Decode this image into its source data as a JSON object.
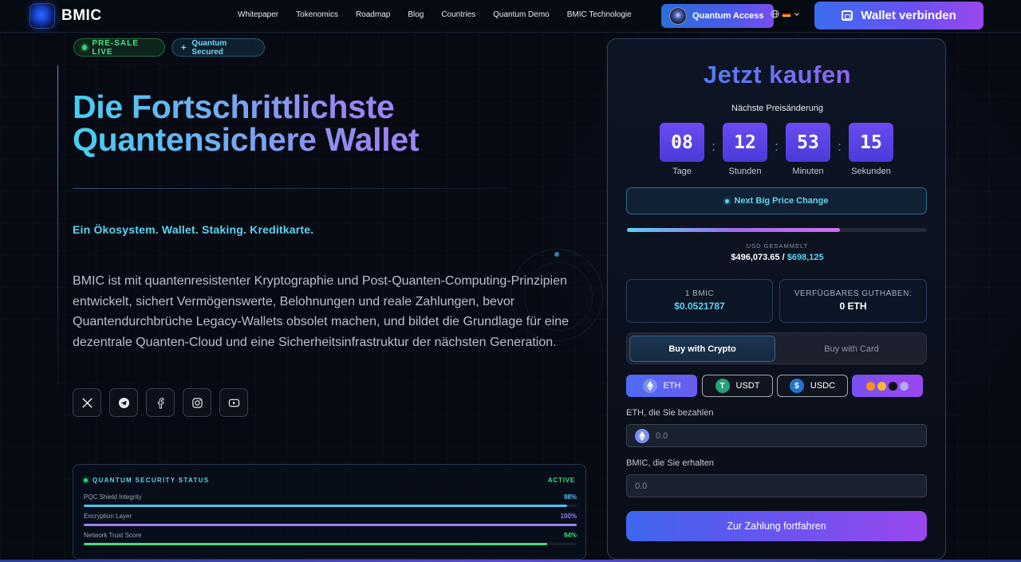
{
  "nav": {
    "logo": "BMIC",
    "links": [
      "Whitepaper",
      "Tokenomics",
      "Roadmap",
      "Blog",
      "Countries",
      "Quantum Demo",
      "BMIC Technologie"
    ],
    "quantum_access": "Quantum Access",
    "wallet_button": "Wallet verbinden"
  },
  "hero": {
    "badge_live": "PRE-SALE LIVE",
    "badge_secured": "Quantum Secured",
    "title_line1": "Die Fortschrittlichste",
    "title_line2": "Quantensichere Wallet",
    "tagline": "Ein Ökosystem. Wallet. Staking. Kreditkarte.",
    "description": "BMIC ist mit quantenresistenter Kryptographie und Post-Quanten-Computing-Prinzipien entwickelt, sichert Vermögenswerte, Belohnungen und reale Zahlungen, bevor Quantendurchbrüche Legacy-Wallets obsolet machen, und bildet die Grundlage für eine dezentrale Quanten-Cloud und eine Sicherheitsinfrastruktur der nächsten Generation.",
    "socials": [
      "x-icon",
      "telegram-icon",
      "facebook-icon",
      "instagram-icon",
      "youtube-icon"
    ]
  },
  "security": {
    "title": "QUANTUM SECURITY STATUS",
    "status": "ACTIVE",
    "metrics": [
      {
        "label": "PQC Shield Integrity",
        "value": "98%",
        "fraction": 0.98,
        "color": "#4fc3e8"
      },
      {
        "label": "Encryption Layer",
        "value": "100%",
        "fraction": 1.0,
        "color": "#9a7cf2"
      },
      {
        "label": "Network Trust Score",
        "value": "94%",
        "fraction": 0.94,
        "color": "#3ee07d"
      }
    ]
  },
  "buy": {
    "title": "Jetzt kaufen",
    "next_price_label": "Nächste Preisänderung",
    "timer": [
      {
        "value": "08",
        "label": "Tage"
      },
      {
        "value": "12",
        "label": "Stunden"
      },
      {
        "value": "53",
        "label": "Minuten"
      },
      {
        "value": "15",
        "label": "Sekunden"
      }
    ],
    "banner": "Next Big Price Change",
    "progress_fraction": 0.711,
    "usd_label": "USD GESAMMELT",
    "usd_raised": "$496,073.65",
    "usd_separator": " / ",
    "usd_goal": "$698,125",
    "price_label": "1 BMIC",
    "price_value": "$0.0521787",
    "balance_label": "VERFÜGBARES GUTHABEN:",
    "balance_value": "0 ETH",
    "tab_crypto": "Buy with Crypto",
    "tab_card": "Buy with Card",
    "coins": [
      "ETH",
      "USDT",
      "USDC"
    ],
    "pay_label": "ETH, die Sie bezahlen",
    "pay_placeholder": "0.0",
    "receive_label": "BMIC, die Sie erhalten",
    "receive_placeholder": "0.0",
    "submit": "Zur Zahlung fortfahren"
  },
  "colors": {
    "accent_cyan": "#5fd3f0",
    "accent_purple": "#7a50f0",
    "live_green": "#34d26e",
    "background": "#070a12"
  }
}
